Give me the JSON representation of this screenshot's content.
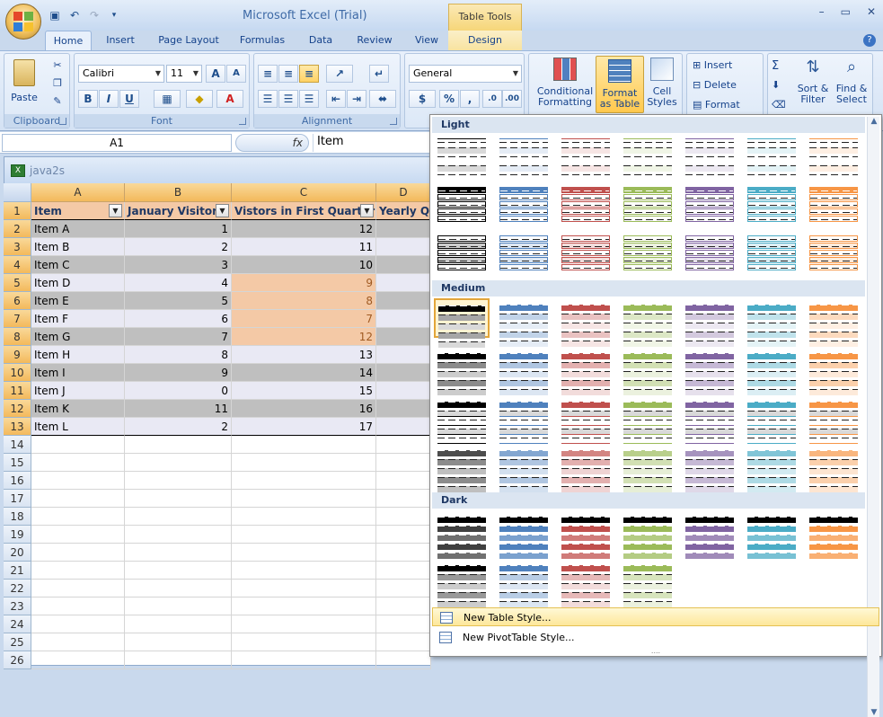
{
  "window": {
    "title": "Microsoft Excel (Trial)",
    "contextual_tab_group": "Table Tools",
    "controls": [
      "–",
      "▭",
      "✕"
    ]
  },
  "ribbon_tabs": [
    "Home",
    "Insert",
    "Page Layout",
    "Formulas",
    "Data",
    "Review",
    "View",
    "Design"
  ],
  "ribbon": {
    "clipboard": {
      "label": "Clipboard",
      "paste": "Paste"
    },
    "font": {
      "label": "Font",
      "family": "Calibri",
      "size": "11",
      "bold": "B",
      "italic": "I",
      "underline": "U"
    },
    "alignment": {
      "label": "Alignment"
    },
    "number": {
      "format": "General",
      "currency": "$",
      "percent": "%",
      "comma": ","
    },
    "styles": {
      "conditional": "Conditional Formatting",
      "format_table": "Format as Table",
      "cell_styles": "Cell Styles"
    },
    "cells": {
      "insert": "Insert",
      "delete": "Delete",
      "format": "Format"
    },
    "editing": {
      "sigma": "Σ",
      "sort": "Sort & Filter",
      "find": "Find & Select"
    }
  },
  "formula_bar": {
    "name_box": "A1",
    "fx": "fx",
    "content": "Item"
  },
  "workbook": {
    "title": "java2s"
  },
  "sheet": {
    "columns": [
      "A",
      "B",
      "C",
      "D"
    ],
    "headers": [
      "Item",
      "January Visitors",
      "Vistors in First Quarter",
      "Yearly Qu"
    ],
    "rows": [
      [
        "Item A",
        "1",
        "12"
      ],
      [
        "Item B",
        "2",
        "11"
      ],
      [
        "Item C",
        "3",
        "10"
      ],
      [
        "Item D",
        "4",
        "9"
      ],
      [
        "Item E",
        "5",
        "8"
      ],
      [
        "Item F",
        "6",
        "7"
      ],
      [
        "Item G",
        "7",
        "12"
      ],
      [
        "Item H",
        "8",
        "13"
      ],
      [
        "Item I",
        "9",
        "14"
      ],
      [
        "Item J",
        "0",
        "15"
      ],
      [
        "Item K",
        "11",
        "16"
      ],
      [
        "Item L",
        "2",
        "17"
      ]
    ],
    "row_numbers": [
      "1",
      "2",
      "3",
      "4",
      "5",
      "6",
      "7",
      "8",
      "9",
      "10",
      "11",
      "12",
      "13",
      "14",
      "15",
      "16",
      "17",
      "18",
      "19",
      "20",
      "21",
      "22",
      "23",
      "24",
      "25",
      "26"
    ]
  },
  "gallery": {
    "sections": [
      "Light",
      "Medium",
      "Dark"
    ],
    "commands": [
      "New Table Style...",
      "New PivotTable Style..."
    ],
    "colors": [
      "#000000",
      "#4f81bd",
      "#c0504d",
      "#9bbb59",
      "#8064a2",
      "#4bacc6",
      "#f79646"
    ]
  }
}
